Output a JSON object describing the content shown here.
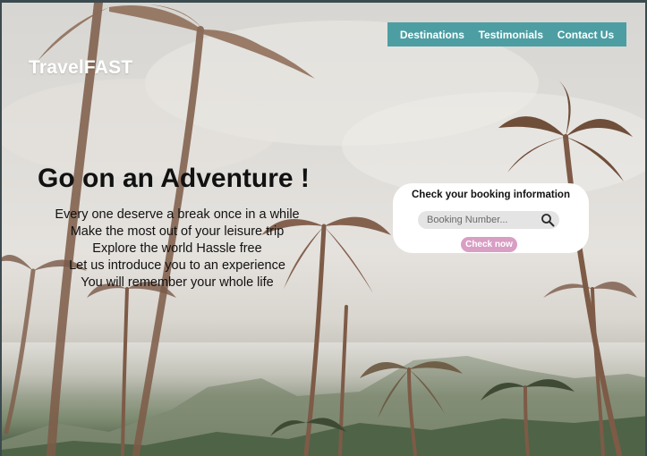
{
  "brand": {
    "logo": "TravelFAST"
  },
  "nav": {
    "items": [
      "Destinations",
      "Testimonials",
      "Contact Us"
    ]
  },
  "hero": {
    "headline_prefix": "Go on an",
    "headline_emphasis": "Adventure !",
    "tagline_lines": [
      "Every one deserve a break once in a while",
      "Make the most out of your leisure trip",
      "Explore the world Hassle free",
      "Let us introduce you to an experience",
      "You will remember your whole life"
    ]
  },
  "booking": {
    "title": "Check your booking information",
    "search_placeholder": "Booking Number...",
    "search_value": "",
    "button_label": "Check now"
  },
  "colors": {
    "nav_bg": "#4d9ea3",
    "button_bg": "#d99ec4",
    "logo_text": "#ffffff"
  },
  "icons": {
    "search": "search-icon"
  }
}
